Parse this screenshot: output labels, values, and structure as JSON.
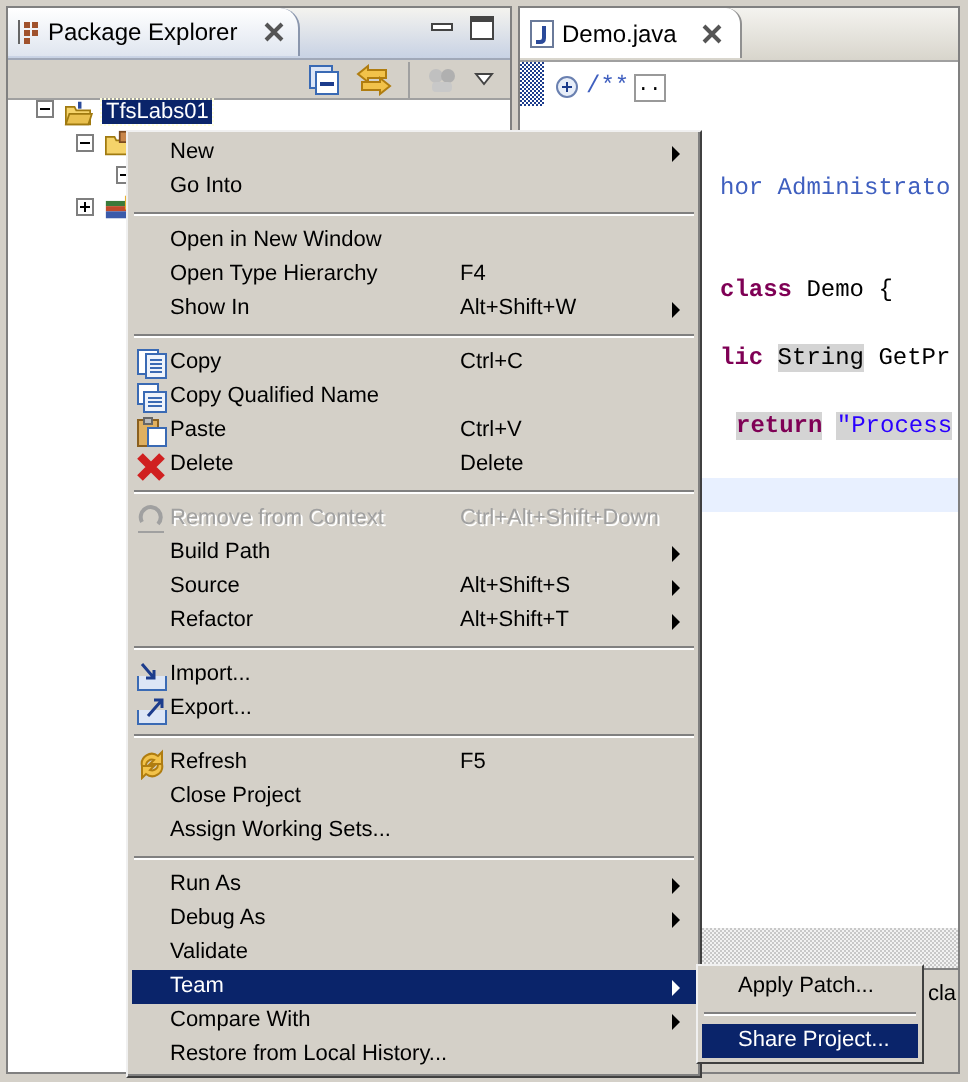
{
  "package_explorer": {
    "title": "Package Explorer",
    "tree": [
      {
        "label": "TfsLabs01",
        "selected": true,
        "expanded": true,
        "kind": "project",
        "children": [
          {
            "expanded": true,
            "kind": "package-folder",
            "children": [
              {
                "expanded": true
              }
            ]
          },
          {
            "expanded": false,
            "kind": "library"
          }
        ]
      }
    ]
  },
  "editor": {
    "tab": "Demo.java",
    "lines": [
      {
        "kind": "fold",
        "segments": [
          {
            "text": "/**",
            "kind": "doc"
          }
        ],
        "folded_marker": ".."
      },
      {
        "kind": "blank"
      },
      {
        "kind": "blank"
      },
      {
        "kind": "code",
        "segments": [
          {
            "text": "hor Administrato",
            "kind": "doc"
          }
        ]
      },
      {
        "kind": "blank"
      },
      {
        "kind": "blank"
      },
      {
        "kind": "code",
        "segments": [
          {
            "text": "class",
            "kind": "keyword"
          },
          {
            "text": "Demo {",
            "kind": "plain"
          }
        ]
      },
      {
        "kind": "blank"
      },
      {
        "kind": "code",
        "segments": [
          {
            "text": "lic",
            "kind": "keyword"
          },
          {
            "text": "String",
            "kind": "occurrence"
          },
          {
            "text": "GetPr",
            "kind": "plain"
          }
        ]
      },
      {
        "kind": "blank"
      },
      {
        "kind": "code",
        "marked": true,
        "segments": [
          {
            "text": "return",
            "kind": "keyword"
          },
          {
            "text": "\"Process",
            "kind": "string"
          }
        ]
      },
      {
        "kind": "blank"
      },
      {
        "kind": "blank",
        "current": true
      }
    ],
    "bottom_panel": {
      "text": "cla"
    }
  },
  "context_menu": [
    {
      "kind": "item",
      "label": "New",
      "submenu": true,
      "disabled": false,
      "selected": false
    },
    {
      "kind": "item",
      "label": "Go Into",
      "submenu": false,
      "disabled": false,
      "selected": false
    },
    {
      "kind": "separator"
    },
    {
      "kind": "item",
      "label": "Open in New Window",
      "submenu": false,
      "disabled": false,
      "selected": false
    },
    {
      "kind": "item",
      "label": "Open Type Hierarchy",
      "shortcut": "F4",
      "submenu": false,
      "disabled": false,
      "selected": false
    },
    {
      "kind": "item",
      "label": "Show In",
      "shortcut": "Alt+Shift+W",
      "submenu": true,
      "disabled": false,
      "selected": false
    },
    {
      "kind": "separator"
    },
    {
      "kind": "copy",
      "label": "Copy",
      "shortcut": "Ctrl+C",
      "submenu": false,
      "disabled": false,
      "selected": false
    },
    {
      "kind": "copy-qualified",
      "label": "Copy Qualified Name",
      "submenu": false,
      "disabled": false,
      "selected": false
    },
    {
      "kind": "paste",
      "label": "Paste",
      "shortcut": "Ctrl+V",
      "submenu": false,
      "disabled": false,
      "selected": false
    },
    {
      "kind": "delete",
      "label": "Delete",
      "shortcut": "Delete",
      "submenu": false,
      "disabled": false,
      "selected": false
    },
    {
      "kind": "separator"
    },
    {
      "kind": "remove",
      "label": "Remove from Context",
      "shortcut": "Ctrl+Alt+Shift+Down",
      "submenu": false,
      "disabled": true,
      "selected": false
    },
    {
      "kind": "item",
      "label": "Build Path",
      "submenu": true,
      "disabled": false,
      "selected": false
    },
    {
      "kind": "item",
      "label": "Source",
      "shortcut": "Alt+Shift+S",
      "submenu": true,
      "disabled": false,
      "selected": false
    },
    {
      "kind": "item",
      "label": "Refactor",
      "shortcut": "Alt+Shift+T",
      "submenu": true,
      "disabled": false,
      "selected": false
    },
    {
      "kind": "separator"
    },
    {
      "kind": "import",
      "label": "Import...",
      "submenu": false,
      "disabled": false,
      "selected": false
    },
    {
      "kind": "export",
      "label": "Export...",
      "submenu": false,
      "disabled": false,
      "selected": false
    },
    {
      "kind": "separator"
    },
    {
      "kind": "refresh",
      "label": "Refresh",
      "shortcut": "F5",
      "submenu": false,
      "disabled": false,
      "selected": false
    },
    {
      "kind": "item",
      "label": "Close Project",
      "submenu": false,
      "disabled": false,
      "selected": false
    },
    {
      "kind": "item",
      "label": "Assign Working Sets...",
      "submenu": false,
      "disabled": false,
      "selected": false
    },
    {
      "kind": "separator"
    },
    {
      "kind": "item",
      "label": "Run As",
      "submenu": true,
      "disabled": false,
      "selected": false
    },
    {
      "kind": "item",
      "label": "Debug As",
      "submenu": true,
      "disabled": false,
      "selected": false
    },
    {
      "kind": "item",
      "label": "Validate",
      "submenu": false,
      "disabled": false,
      "selected": false
    },
    {
      "kind": "item",
      "label": "Team",
      "submenu": true,
      "disabled": false,
      "selected": true
    },
    {
      "kind": "item",
      "label": "Compare With",
      "submenu": true,
      "disabled": false,
      "selected": false
    },
    {
      "kind": "item",
      "label": "Restore from Local History...",
      "submenu": false,
      "disabled": false,
      "selected": false
    }
  ],
  "team_submenu": [
    {
      "kind": "item",
      "label": "Apply Patch...",
      "selected": false
    },
    {
      "kind": "separator"
    },
    {
      "kind": "item",
      "label": "Share Project...",
      "selected": true
    }
  ]
}
